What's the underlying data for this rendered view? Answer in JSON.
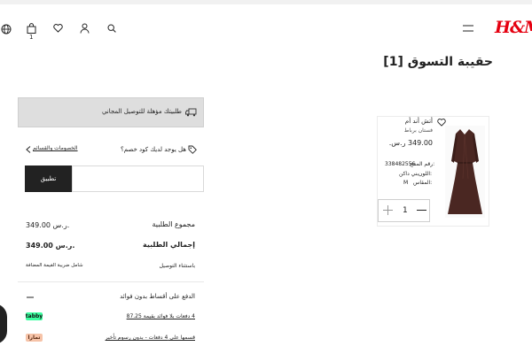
{
  "header": {
    "logo_text": "H&M",
    "brand_color": "#e50010",
    "icons": [
      "globe-icon",
      "shopping-bag-icon",
      "heart-icon",
      "user-icon",
      "search-icon",
      "menu-icon"
    ],
    "bag_count": "1"
  },
  "page": {
    "title": "حقيبة التسوق [1]"
  },
  "product": {
    "name": "أتش أند أم",
    "subtitle": "فستان برباط",
    "price": "349.00 ر.س.",
    "article_label": "رقم المنتج:",
    "article_value": "338482556",
    "color_label": "اللون:",
    "color_value": "بني داكن",
    "size_label": "المقاس:",
    "size_value": "M",
    "quantity": "1",
    "image_color": "#4a2722"
  },
  "shipping_banner": {
    "text": "طلبيتك مؤهلة للتوصيل المجاني"
  },
  "promo": {
    "question": "هل يوجد لديك كود خصم؟",
    "link": "الخصومات والقسائم",
    "input_placeholder": "",
    "apply_label": "تطبيق"
  },
  "summary": {
    "order_value_label": "مجموع الطلبية",
    "order_value": "349.00 ر.س.",
    "total_label": "إجمالي الطلبية",
    "total_value": "349.00 ر.س.",
    "delivery_note": "باستثناء التوصيل",
    "vat_note": "شامل ضريبة القيمة المضافة"
  },
  "installments": {
    "title": "الدفع على أقساط بدون فوائد",
    "tabby_text": "4 دفعات بلا فوائد بقيمة 87.25",
    "tabby_badge": "tabby",
    "tabby_color": "#3bffa0",
    "tamara_text": "قسمها على 4 دفعات - بدون رسوم تأخير",
    "tamara_badge": "تمارا",
    "tamara_color": "#f6c3a8"
  }
}
